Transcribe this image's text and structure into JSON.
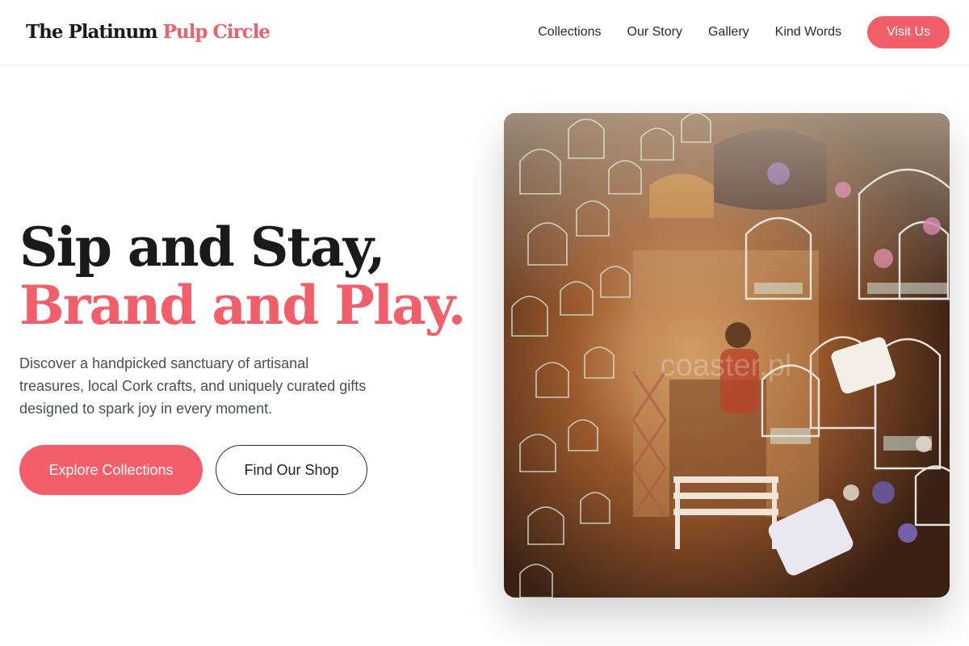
{
  "header": {
    "logo_main": "The Platinum ",
    "logo_accent": "Pulp Circle",
    "nav": [
      "Collections",
      "Our Story",
      "Gallery",
      "Kind Words"
    ],
    "cta": "Visit Us"
  },
  "hero": {
    "title_line1": "Sip and Stay,",
    "title_line2": "Brand and Play.",
    "description": "Discover a handpicked sanctuary of artisanal treasures, local Cork crafts, and uniquely curated gifts designed to spark joy in every moment.",
    "primary_button": "Explore Collections",
    "secondary_button": "Find Our Shop"
  },
  "image": {
    "watermark": "coaster.pl"
  },
  "colors": {
    "accent": "#f25f6b",
    "text_dark": "#1a1a1a",
    "text_muted": "#4a4f55"
  }
}
